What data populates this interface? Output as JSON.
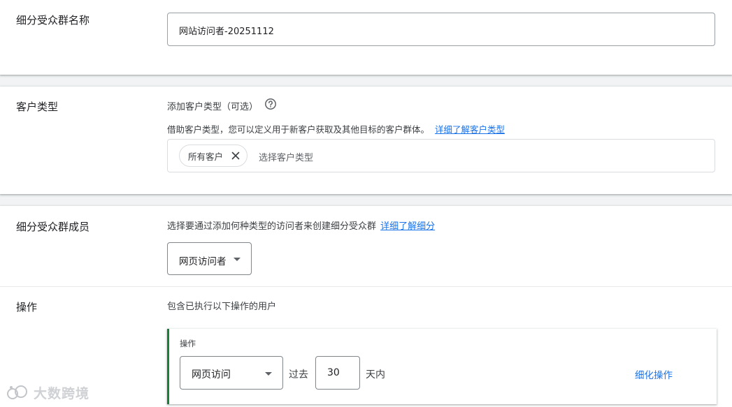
{
  "audience_name": {
    "label": "细分受众群名称",
    "value": "网站访问者-20251112"
  },
  "customer_type": {
    "label": "客户类型",
    "heading": "添加客户类型（可选）",
    "description": "借助客户类型，您可以定义用于新客户获取及其他目标的客户群体。",
    "learn_more": "详细了解客户类型",
    "chip": "所有客户",
    "placeholder": "选择客户类型"
  },
  "members": {
    "label": "细分受众群成员",
    "description": "选择要通过添加何种类型的访问者来创建细分受众群",
    "learn_more": "详细了解细分",
    "dropdown_value": "网页访问者"
  },
  "actions": {
    "label": "操作",
    "description": "包含已执行以下操作的用户",
    "panel_label": "操作",
    "action_value": "网页访问",
    "past_label": "过去",
    "days_value": "30",
    "days_suffix": "天内",
    "refine_label": "细化操作",
    "accent": "#188038"
  },
  "watermark": "大数跨境",
  "colors": {
    "link": "#1a73e8",
    "border": "#9aa0a6",
    "accent": "#188038"
  }
}
